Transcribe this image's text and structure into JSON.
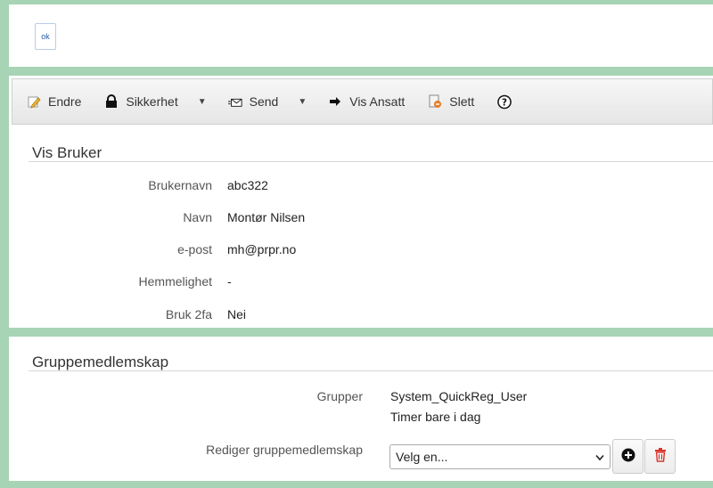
{
  "top": {
    "ok_label": "ok"
  },
  "toolbar": {
    "items": [
      {
        "label": "Endre",
        "icon": "edit-icon"
      },
      {
        "label": "Sikkerhet",
        "icon": "lock-icon"
      },
      {
        "label": "Send",
        "icon": "mail-icon"
      },
      {
        "label": "Vis Ansatt",
        "icon": "arrow-right-icon"
      },
      {
        "label": "Slett",
        "icon": "delete-doc-icon"
      }
    ],
    "help_icon": "help-icon"
  },
  "user": {
    "title": "Vis Bruker",
    "fields": [
      {
        "label": "Brukernavn",
        "value": "abc322"
      },
      {
        "label": "Navn",
        "value": "Montør Nilsen"
      },
      {
        "label": "e-post",
        "value": "mh@prpr.no"
      },
      {
        "label": "Hemmelighet",
        "value": "-"
      },
      {
        "label": "Bruk 2fa",
        "value": "Nei"
      }
    ]
  },
  "groups": {
    "title": "Gruppemedlemskap",
    "groups_label": "Grupper",
    "groups_values": [
      "System_QuickReg_User",
      "Timer bare i dag"
    ],
    "edit_label": "Rediger gruppemedlemskap",
    "select_value": "Velg en...",
    "colors": {
      "delete": "#d9342b"
    }
  }
}
